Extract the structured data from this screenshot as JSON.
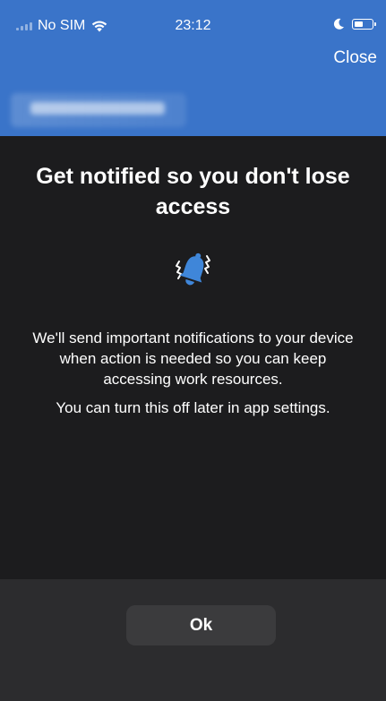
{
  "status_bar": {
    "carrier": "No SIM",
    "time": "23:12",
    "icons": [
      "signal-icon",
      "wifi-icon",
      "moon-icon",
      "battery-icon"
    ]
  },
  "header": {
    "close_label": "Close",
    "account_name_blurred": true
  },
  "main": {
    "title": "Get notified so you don't lose access",
    "illustration_icon": "bell-ringing-icon",
    "description": "We'll send important notifications to your device when action is needed so you can keep accessing work resources.",
    "note": "You can turn this off later in app settings."
  },
  "footer": {
    "ok_label": "Ok"
  },
  "colors": {
    "header_blue": "#3a74c9",
    "background_dark": "#1c1c1e",
    "footer_dark": "#2c2c2e",
    "button_gray": "#3b3b3d",
    "bell_blue": "#3f86d9"
  }
}
